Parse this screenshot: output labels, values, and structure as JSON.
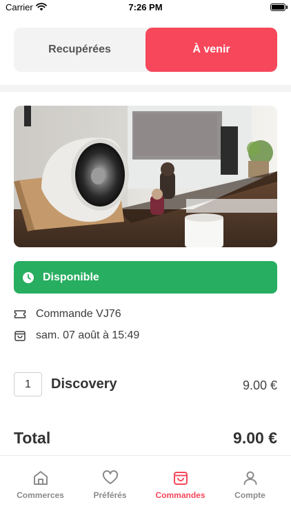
{
  "status_bar": {
    "carrier": "Carrier",
    "time": "7:26 PM"
  },
  "segment": {
    "left_label": "Recupérées",
    "right_label": "À venir"
  },
  "order": {
    "status": "Disponible",
    "number": "Commande VJ76",
    "date": "sam. 07 août à 15:49"
  },
  "item": {
    "quantity": "1",
    "name": "Discovery",
    "price": "9.00 €"
  },
  "total": {
    "label": "Total",
    "value": "9.00 €"
  },
  "tabs": [
    {
      "label": "Commerces",
      "icon": "home-icon"
    },
    {
      "label": "Préférés",
      "icon": "heart-icon"
    },
    {
      "label": "Commandes",
      "icon": "shopping-bag-icon"
    },
    {
      "label": "Compte",
      "icon": "user-icon"
    }
  ],
  "colors": {
    "accent": "#f6475b",
    "available": "#27ae60"
  }
}
